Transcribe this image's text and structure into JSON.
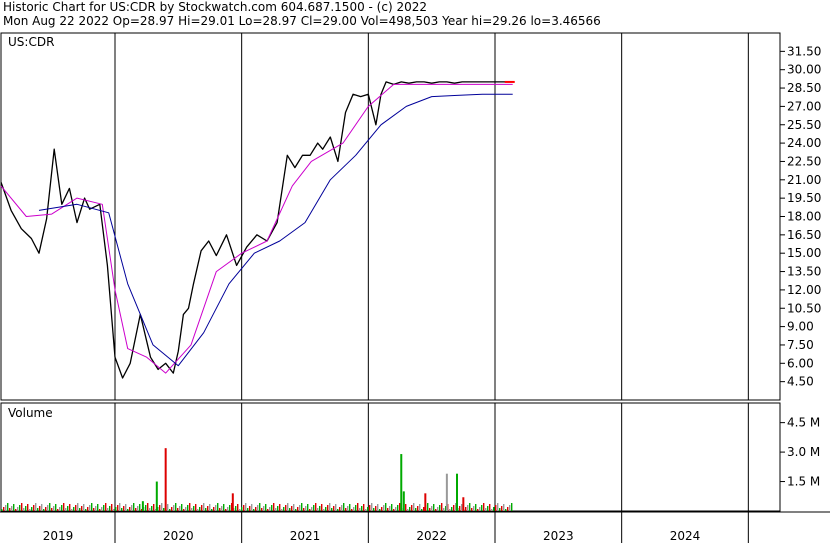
{
  "header": {
    "line1": "Historic Chart for US:CDR by Stockwatch.com 604.687.1500 - (c) 2022",
    "line2": "Mon Aug 22 2022   Op=28.97  Hi=29.01  Lo=28.97  Cl=29.00  Vol=498,503   Year hi=29.26  lo=3.46566"
  },
  "colors": {
    "price": "#000000",
    "ma_short": "#cc00cc",
    "ma_long": "#000099",
    "vol_up": "#00aa00",
    "vol_down": "#dd0000",
    "vol_flat": "#999999",
    "grid": "#000000",
    "last": "#ff0000"
  },
  "chart_data": [
    {
      "type": "line",
      "title": "US:CDR",
      "y_ticks": [
        "31.50",
        "30.00",
        "28.50",
        "27.00",
        "25.50",
        "24.00",
        "22.50",
        "21.00",
        "19.50",
        "18.00",
        "16.50",
        "15.00",
        "13.50",
        "12.00",
        "10.50",
        "9.00",
        "7.50",
        "6.00",
        "4.50"
      ],
      "x_ticks": [
        "2019",
        "2020",
        "2021",
        "2022",
        "2023",
        "2024"
      ],
      "ylim": [
        3.0,
        33.0
      ],
      "grid": true,
      "series": [
        {
          "key": "price",
          "x": [
            2018.6,
            2018.68,
            2018.76,
            2018.84,
            2018.9,
            2018.96,
            2019.02,
            2019.08,
            2019.14,
            2019.2,
            2019.26,
            2019.3,
            2019.38,
            2019.44,
            2019.5,
            2019.56,
            2019.62,
            2019.7,
            2019.78,
            2019.84,
            2019.9,
            2019.96,
            2020.0,
            2020.04,
            2020.08,
            2020.12,
            2020.18,
            2020.24,
            2020.3,
            2020.38,
            2020.46,
            2020.54,
            2020.62,
            2020.7,
            2020.78,
            2020.86,
            2020.92,
            2020.98,
            2021.04,
            2021.1,
            2021.14,
            2021.2,
            2021.26,
            2021.32,
            2021.38,
            2021.44,
            2021.5,
            2021.56,
            2021.6,
            2021.64,
            2021.7,
            2021.76,
            2021.82,
            2021.88,
            2021.94,
            2022.0,
            2022.06,
            2022.12,
            2022.18,
            2022.24,
            2022.3,
            2022.36,
            2022.42,
            2022.48,
            2022.54,
            2022.6,
            2022.64
          ],
          "y": [
            20.8,
            18.5,
            17.0,
            16.2,
            15.0,
            17.8,
            23.5,
            19.0,
            20.3,
            17.5,
            19.5,
            18.6,
            19.0,
            14.0,
            6.5,
            4.8,
            6.0,
            10.0,
            6.5,
            5.5,
            6.0,
            5.2,
            7.0,
            10.0,
            10.5,
            12.5,
            15.2,
            16.0,
            14.8,
            16.5,
            14.0,
            15.5,
            16.5,
            16.0,
            17.5,
            23.0,
            22.0,
            23.0,
            23.0,
            24.0,
            23.5,
            24.5,
            22.5,
            26.5,
            28.0,
            27.8,
            28.0,
            25.5,
            28.0,
            29.0,
            28.8,
            29.0,
            28.9,
            29.0,
            29.0,
            28.9,
            29.0,
            29.0,
            28.9,
            29.0,
            29.0,
            29.0,
            29.0,
            29.0,
            29.0,
            29.0,
            29.0
          ]
        },
        {
          "key": "ma_short",
          "x": [
            2018.6,
            2018.8,
            2019.0,
            2019.2,
            2019.4,
            2019.5,
            2019.6,
            2019.75,
            2019.9,
            2020.1,
            2020.3,
            2020.5,
            2020.7,
            2020.9,
            2021.05,
            2021.3,
            2021.5,
            2021.7,
            2021.9,
            2022.1,
            2022.3,
            2022.5,
            2022.64
          ],
          "y": [
            20.5,
            18.0,
            18.2,
            19.5,
            19.0,
            12.0,
            7.2,
            6.5,
            5.2,
            7.5,
            13.5,
            15.0,
            16.0,
            20.5,
            22.5,
            24.0,
            27.0,
            28.8,
            28.8,
            28.8,
            28.8,
            28.8,
            28.8
          ]
        },
        {
          "key": "ma_long",
          "x": [
            2018.9,
            2019.2,
            2019.45,
            2019.6,
            2019.8,
            2020.0,
            2020.2,
            2020.4,
            2020.6,
            2020.8,
            2021.0,
            2021.2,
            2021.4,
            2021.6,
            2021.8,
            2022.0,
            2022.2,
            2022.4,
            2022.64
          ],
          "y": [
            18.5,
            19.0,
            18.3,
            12.5,
            7.5,
            5.8,
            8.5,
            12.5,
            15.0,
            16.0,
            17.5,
            21.0,
            23.0,
            25.5,
            27.0,
            27.8,
            27.9,
            28.0,
            28.0
          ]
        }
      ]
    },
    {
      "type": "bar",
      "title": "Volume",
      "y_ticks": [
        "4.5 M",
        "3.0 M",
        "1.5 M"
      ],
      "ylim": [
        0,
        5500000
      ],
      "spikes": [
        {
          "x": 2019.72,
          "value": 500000,
          "color": "vol_up"
        },
        {
          "x": 2019.83,
          "value": 1500000,
          "color": "vol_up"
        },
        {
          "x": 2019.9,
          "value": 3200000,
          "color": "vol_down"
        },
        {
          "x": 2020.43,
          "value": 900000,
          "color": "vol_down"
        },
        {
          "x": 2021.76,
          "value": 2900000,
          "color": "vol_up"
        },
        {
          "x": 2021.78,
          "value": 1000000,
          "color": "vol_up"
        },
        {
          "x": 2021.95,
          "value": 900000,
          "color": "vol_down"
        },
        {
          "x": 2022.12,
          "value": 1900000,
          "color": "vol_flat"
        },
        {
          "x": 2022.2,
          "value": 1900000,
          "color": "vol_up"
        },
        {
          "x": 2022.25,
          "value": 700000,
          "color": "vol_down"
        }
      ]
    }
  ]
}
